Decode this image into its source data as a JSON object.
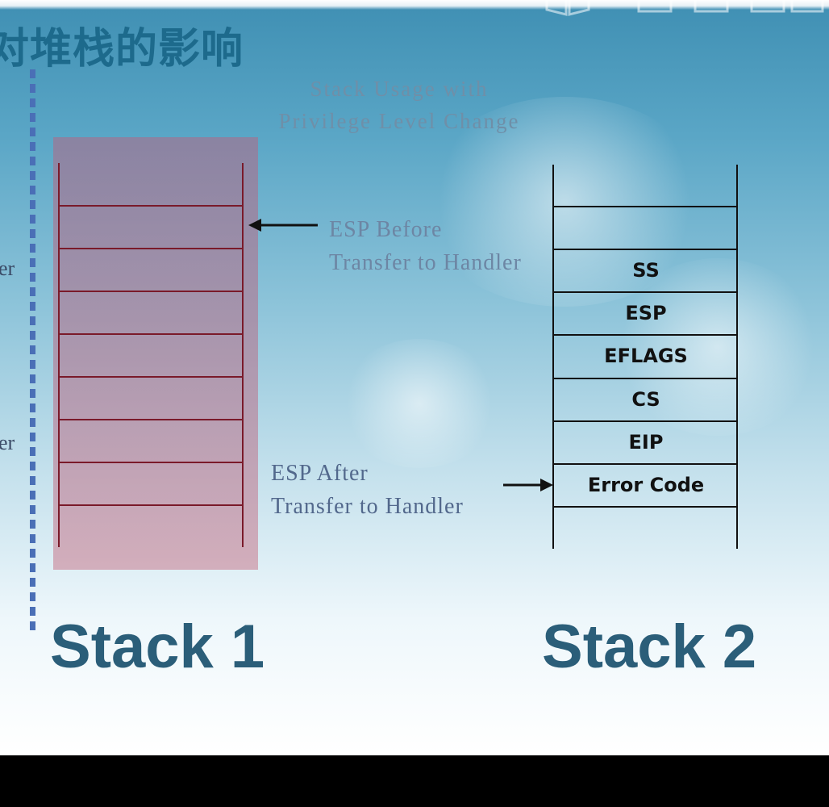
{
  "slide": {
    "title": "对堆栈的影响",
    "subtitle_line1": "Stack Usage with",
    "subtitle_line2": "Privilege Level Change",
    "left_edge_fragment_1": "er",
    "left_edge_fragment_2": "er"
  },
  "stack1": {
    "caption": "Stack 1",
    "rows": 9,
    "esp_before_line1": "ESP Before",
    "esp_before_line2": "Transfer to Handler"
  },
  "stack2": {
    "caption": "Stack 2",
    "cells": [
      "SS",
      "ESP",
      "EFLAGS",
      "CS",
      "EIP",
      "Error Code"
    ],
    "esp_after_line1": "ESP After",
    "esp_after_line2": "Transfer to Handler"
  },
  "colors": {
    "title": "#1d6a8c",
    "stack1_lines": "#7a1a2a",
    "stack1_highlight": "#b9788f",
    "stack2_lines": "#111111",
    "caption": "#2b5e79"
  },
  "icons": {
    "logo": "watermark-logo-icon",
    "arrow_before": "arrow-left-icon",
    "arrow_after": "arrow-right-icon"
  }
}
